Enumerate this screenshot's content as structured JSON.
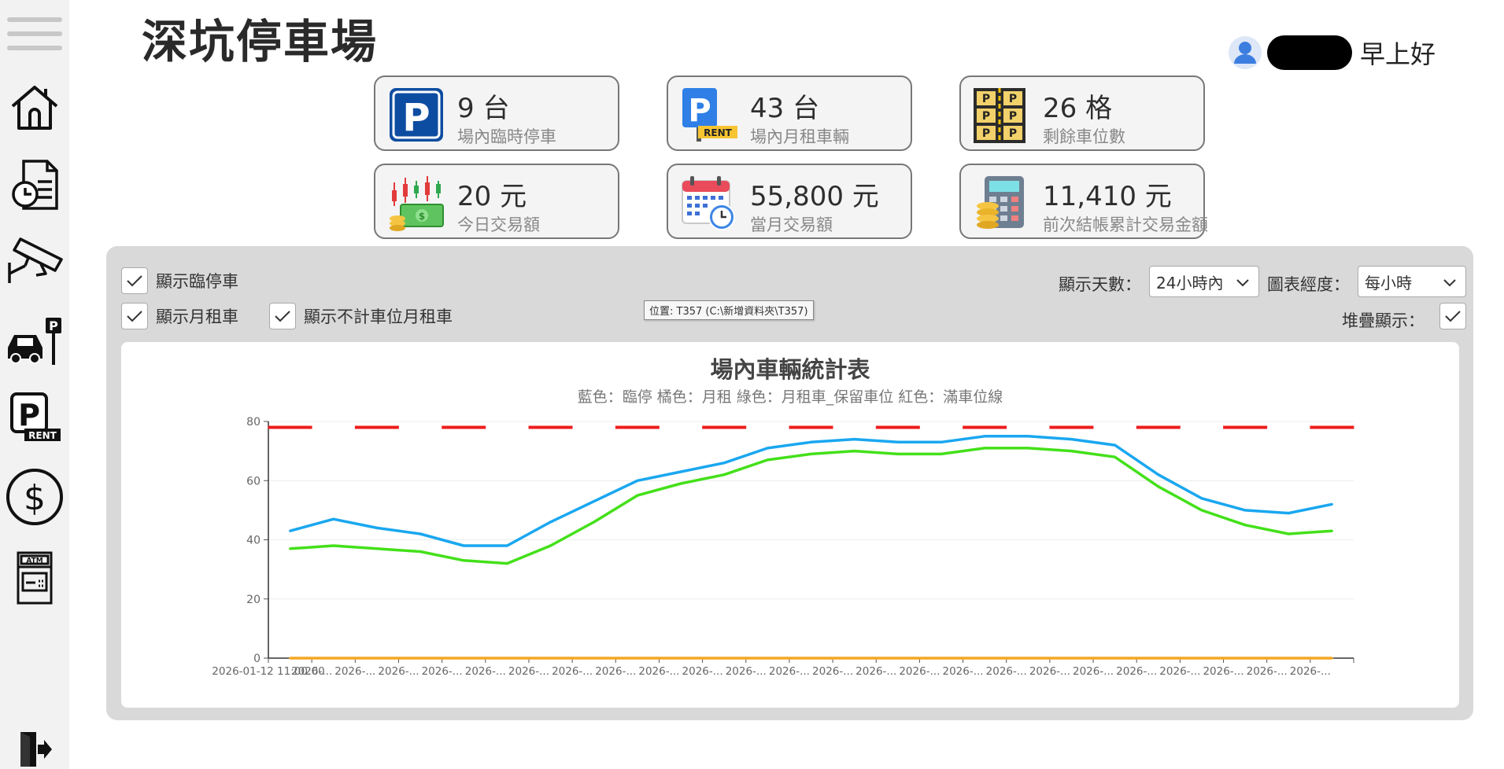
{
  "header": {
    "title": "深坑停車場",
    "greeting": "早上好"
  },
  "sidebar": {
    "items": [
      {
        "name": "menu"
      },
      {
        "name": "home"
      },
      {
        "name": "records"
      },
      {
        "name": "camera"
      },
      {
        "name": "parking"
      },
      {
        "name": "rent"
      },
      {
        "name": "payment"
      },
      {
        "name": "atm"
      },
      {
        "name": "logout"
      }
    ]
  },
  "cards": [
    {
      "value": "9 台",
      "label": "場內臨時停車",
      "icon": "parking-sign-icon"
    },
    {
      "value": "43 台",
      "label": "場內月租車輛",
      "icon": "parking-rent-icon"
    },
    {
      "value": "26 格",
      "label": "剩餘車位數",
      "icon": "parking-spaces-icon"
    },
    {
      "value": "20 元",
      "label": "今日交易額",
      "icon": "money-chart-icon"
    },
    {
      "value": "55,800 元",
      "label": "當月交易額",
      "icon": "calendar-clock-icon"
    },
    {
      "value": "11,410 元",
      "label": "前次結帳累計交易金額",
      "icon": "calculator-coins-icon"
    }
  ],
  "controls": {
    "show_temp": {
      "label": "顯示臨停車",
      "checked": true
    },
    "show_monthly": {
      "label": "顯示月租車",
      "checked": true
    },
    "show_unreserved_monthly": {
      "label": "顯示不計車位月租車",
      "checked": true
    },
    "days_label": "顯示天數：",
    "days_value": "24小時內",
    "granularity_label": "圖表經度：",
    "granularity_value": "每小時",
    "stack_label": "堆疊顯示：",
    "stack_checked": true
  },
  "tooltip": "位置: T357 (C:\\新增資料夾\\T357)",
  "chart_data": {
    "type": "line",
    "title": "場內車輛統計表",
    "subtitle": "藍色：臨停  橘色：月租  綠色：月租車_保留車位  紅色：滿車位線",
    "ylim": [
      0,
      80
    ],
    "yticks": [
      "0",
      "20",
      "40",
      "60",
      "80"
    ],
    "x_tick_labels": [
      "2026-01-12 11:00:00",
      "2026-...",
      "2026-...",
      "2026-...",
      "2026-...",
      "2026-...",
      "2026-...",
      "2026-...",
      "2026-...",
      "2026-...",
      "2026-...",
      "2026-...",
      "2026-...",
      "2026-...",
      "2026-...",
      "2026-...",
      "2026-...",
      "2026-...",
      "2026-...",
      "2026-...",
      "2026-...",
      "2026-...",
      "2026-...",
      "2026-...",
      "2026-..."
    ],
    "series": [
      {
        "color": "#1aa7f0",
        "values": [
          43,
          47,
          44,
          42,
          38,
          38,
          46,
          53,
          60,
          63,
          66,
          71,
          73,
          74,
          73,
          73,
          75,
          75,
          74,
          72,
          62,
          54,
          50,
          49,
          52
        ]
      },
      {
        "color": "#44e01a",
        "values": [
          37,
          38,
          37,
          36,
          33,
          32,
          38,
          46,
          55,
          59,
          62,
          67,
          69,
          70,
          69,
          69,
          71,
          71,
          70,
          68,
          58,
          50,
          45,
          42,
          43
        ]
      },
      {
        "color": "#f5a623",
        "values": [
          0,
          0,
          0,
          0,
          0,
          0,
          0,
          0,
          0,
          0,
          0,
          0,
          0,
          0,
          0,
          0,
          0,
          0,
          0,
          0,
          0,
          0,
          0,
          0,
          0
        ]
      },
      {
        "color": "#ee1c1c",
        "dashed": true,
        "values": [
          78,
          78,
          78,
          78,
          78,
          78,
          78,
          78,
          78,
          78,
          78,
          78,
          78,
          78,
          78,
          78,
          78,
          78,
          78,
          78,
          78,
          78,
          78,
          78,
          78
        ]
      }
    ],
    "grid": true
  }
}
